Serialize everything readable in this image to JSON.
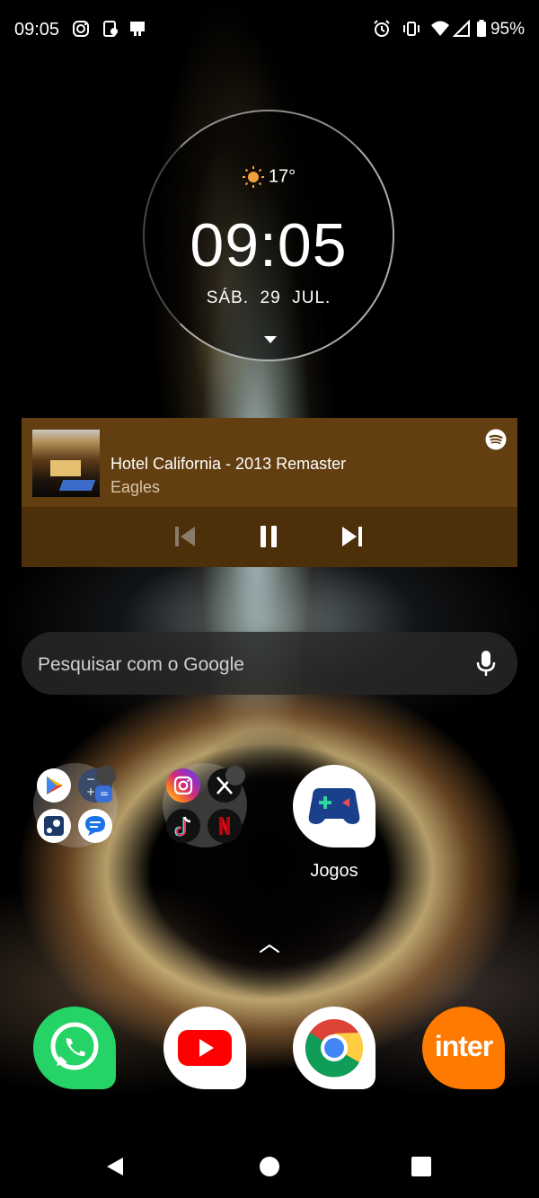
{
  "status_bar": {
    "time": "09:05",
    "battery": "95%",
    "left_icons": [
      "instagram-icon",
      "notification-icon",
      "notification-icon"
    ],
    "right_icons": [
      "alarm-icon",
      "vibrate-icon",
      "wifi-icon",
      "signal-icon",
      "battery-icon"
    ]
  },
  "clock_widget": {
    "temperature": "17°",
    "time": "09:05",
    "date": "SÁB.  29  JUL."
  },
  "media_player": {
    "track_title": "Hotel California - 2013 Remaster",
    "artist": "Eagles",
    "background_color": "#623e10",
    "controls_bg": "#4d2f0a"
  },
  "search": {
    "placeholder": "Pesquisar com o Google"
  },
  "home": {
    "folders": [
      {
        "apps": [
          "play-store-icon",
          "calculator-icon",
          "steam-icon",
          "messages-icon"
        ]
      },
      {
        "apps": [
          "instagram-icon",
          "x-icon",
          "tiktok-icon",
          "netflix-icon"
        ]
      }
    ],
    "apps": [
      {
        "label": "Jogos",
        "icon": "games-icon"
      }
    ]
  },
  "dock": [
    {
      "icon": "whatsapp-icon",
      "color": "#25d366"
    },
    {
      "icon": "youtube-icon",
      "color": "#ff0000"
    },
    {
      "icon": "chrome-icon",
      "color": "#4285f4"
    },
    {
      "icon": "inter-icon",
      "text": "inter",
      "color": "#ff7a00"
    }
  ]
}
